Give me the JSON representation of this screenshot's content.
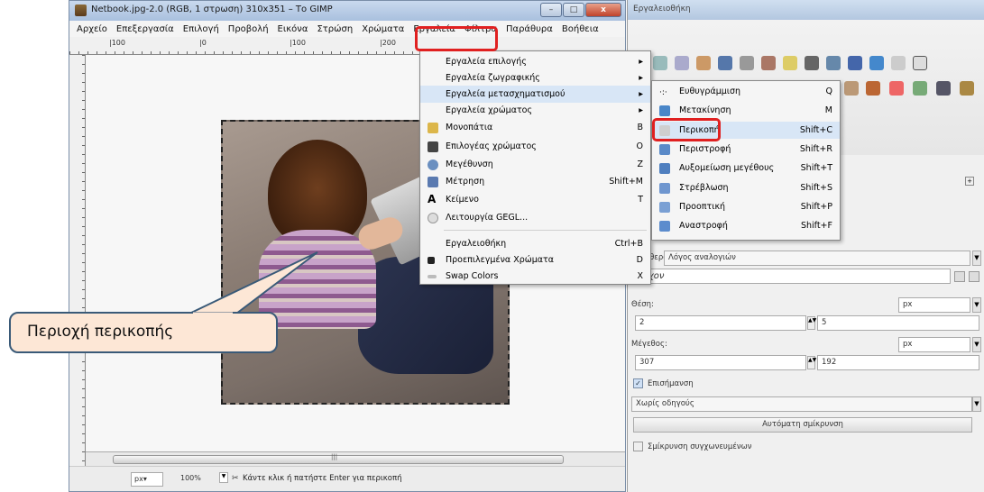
{
  "image_window": {
    "title": "Netbook.jpg-2.0 (RGB, 1 στρωση) 310x351 – Το GIMP",
    "menus": [
      "Αρχείο",
      "Επεξεργασία",
      "Επιλογή",
      "Προβολή",
      "Εικόνα",
      "Στρώση",
      "Χρώματα",
      "Εργαλεία",
      "Φίλτρα",
      "Παράθυρα",
      "Βοήθεια"
    ],
    "ruler_labels": [
      "|100",
      "|0",
      "|100",
      "|200"
    ],
    "status": {
      "unit": "px▾",
      "zoom": "100%",
      "hint": "Κάντε κλικ ή πατήστε Enter για περικοπή"
    }
  },
  "tools_menu": {
    "items": [
      {
        "label": "Εργαλεία επιλογής",
        "shortcut": "▸"
      },
      {
        "label": "Εργαλεία ζωγραφικής",
        "shortcut": "▸"
      },
      {
        "label": "Εργαλεία μετασχηματισμού",
        "shortcut": "▸"
      },
      {
        "label": "Εργαλεία χρώματος",
        "shortcut": "▸"
      },
      {
        "label": "Μονοπάτια",
        "shortcut": "B"
      },
      {
        "label": "Επιλογέας χρώματος",
        "shortcut": "O"
      },
      {
        "label": "Μεγέθυνση",
        "shortcut": "Z"
      },
      {
        "label": "Μέτρηση",
        "shortcut": "Shift+M"
      },
      {
        "label": "Κείμενο",
        "shortcut": "T"
      },
      {
        "label": "Λειτουργία GEGL...",
        "shortcut": ""
      },
      {
        "label": "Εργαλειοθήκη",
        "shortcut": "Ctrl+B"
      },
      {
        "label": "Προεπιλεγμένα Χρώματα",
        "shortcut": "D"
      },
      {
        "label": "Swap Colors",
        "shortcut": "X"
      }
    ]
  },
  "transform_menu": {
    "items": [
      {
        "label": "Ευθυγράμμιση",
        "shortcut": "Q"
      },
      {
        "label": "Μετακίνηση",
        "shortcut": "M"
      },
      {
        "label": "Περικοπή",
        "shortcut": "Shift+C"
      },
      {
        "label": "Περιστροφή",
        "shortcut": "Shift+R"
      },
      {
        "label": "Αυξομείωση μεγέθους",
        "shortcut": "Shift+T"
      },
      {
        "label": "Στρέβλωση",
        "shortcut": "Shift+S"
      },
      {
        "label": "Προοπτική",
        "shortcut": "Shift+P"
      },
      {
        "label": "Αναστροφή",
        "shortcut": "Shift+F"
      }
    ]
  },
  "toolbox": {
    "title": "Εργαλειοθήκη",
    "fixed_label": "Σταθερό:",
    "fixed_value": "Λόγος αναλογιών",
    "current_value": "Τρέχον",
    "position_label": "Θέση:",
    "position_unit": "px",
    "position_x": "2",
    "position_y": "5",
    "size_label": "Μέγεθος:",
    "size_unit": "px",
    "size_w": "307",
    "size_h": "192",
    "highlight_label": "Επισήμανση",
    "guides_value": "Χωρίς οδηγούς",
    "autoshrink_button": "Αυτόματη σμίκρυνση",
    "shrink_merged_label": "Σμίκρυνση συγχωνευμένων"
  },
  "callout": {
    "text": "Περιοχή περικοπής"
  },
  "colors": {
    "highlight_red": "#e02020",
    "callout_fill": "#fde7d6",
    "menu_hover": "#d8e6f6"
  }
}
